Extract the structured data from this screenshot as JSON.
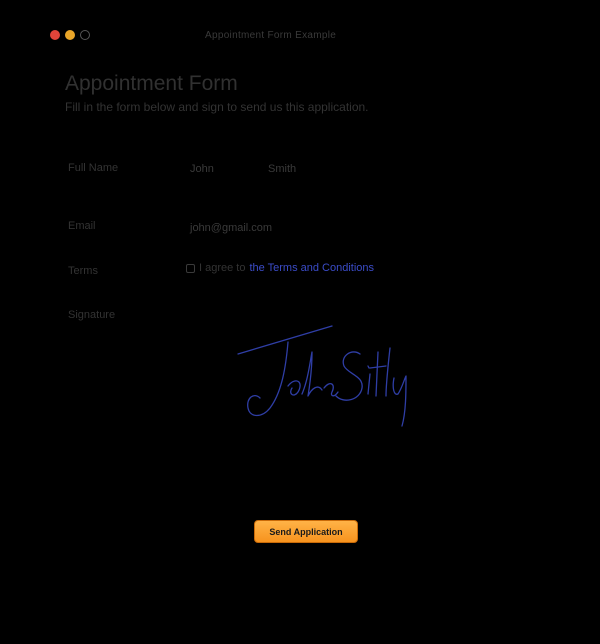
{
  "window": {
    "title": "Appointment Form Example"
  },
  "form": {
    "title": "Appointment Form",
    "subtitle": "Fill in the form below and sign to send us this application.",
    "full_name": {
      "label": "Full Name",
      "first_name": "John",
      "last_name": "Smith"
    },
    "email": {
      "label": "Email",
      "value": "john@gmail.com"
    },
    "terms": {
      "label": "Terms",
      "checked": false,
      "text": "I agree to ",
      "link_text": "the Terms and Conditions"
    },
    "signature": {
      "label": "Signature"
    },
    "submit_label": "Send Application"
  },
  "colors": {
    "background": "#000000",
    "link": "#3b4cc8",
    "button": "#f7931e",
    "signature_ink": "#2f3ea6",
    "close_dot": "#e0443a",
    "minimize_dot": "#e9a528"
  }
}
